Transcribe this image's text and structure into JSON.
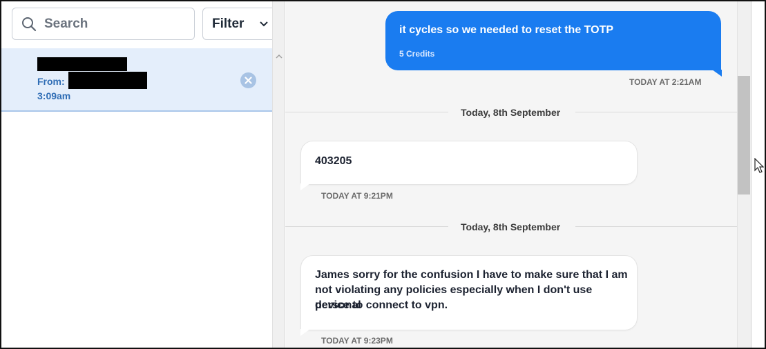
{
  "search": {
    "placeholder": "Search",
    "icon": "search-icon"
  },
  "filter": {
    "label": "Filter",
    "icon": "chevron-down-icon"
  },
  "conversation": {
    "from_label": "From:",
    "time": "3:09am",
    "close_icon": "close-circle-icon"
  },
  "messages": [
    {
      "direction": "outgoing",
      "text": "it cycles so we needed to reset the TOTP",
      "credits": "5 Credits",
      "timestamp": "TODAY AT 2:21AM"
    },
    {
      "divider": "Today, 8th September"
    },
    {
      "direction": "incoming",
      "text": "403205",
      "timestamp": "TODAY AT 9:21PM"
    },
    {
      "divider": "Today, 8th September"
    },
    {
      "direction": "incoming",
      "lines": [
        "James sorry for the confusion I have to make sure that I am",
        "not violating any policies especially when I don't use personal",
        "device to connect to vpn."
      ],
      "timestamp": "TODAY AT 9:23PM"
    }
  ],
  "colors": {
    "outgoing_bubble": "#1a7cf0",
    "selected_item": "#e4eefb",
    "accent_text": "#2f6db5"
  }
}
